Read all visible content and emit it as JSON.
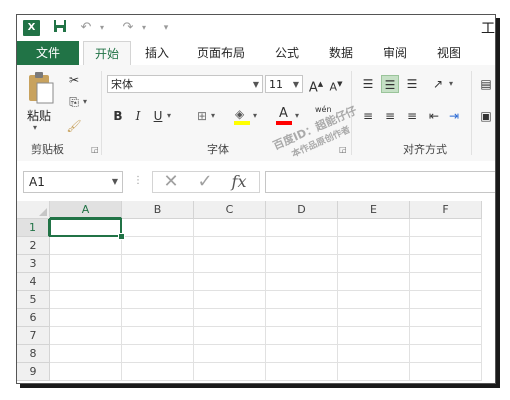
{
  "app": {
    "logo": "X",
    "title_fragment": "工"
  },
  "quick_access": {
    "save_icon": "save-icon",
    "undo_icon": "undo-icon",
    "redo_icon": "redo-icon",
    "customize_icon": "customize-qat-icon"
  },
  "tabs": [
    {
      "label": "文件"
    },
    {
      "label": "开始"
    },
    {
      "label": "插入"
    },
    {
      "label": "页面布局"
    },
    {
      "label": "公式"
    },
    {
      "label": "数据"
    },
    {
      "label": "审阅"
    },
    {
      "label": "视图"
    }
  ],
  "ribbon": {
    "clipboard": {
      "paste_label": "粘贴",
      "group_label": "剪贴板"
    },
    "font": {
      "font_name": "宋体",
      "font_size": "11",
      "grow_label": "A",
      "shrink_label": "A",
      "bold": "B",
      "italic": "I",
      "underline": "U",
      "font_color_label": "A",
      "wen_label": "wén",
      "group_label": "字体"
    },
    "alignment": {
      "group_label": "对齐方式"
    }
  },
  "watermark": {
    "line1": "百度ID：超能仔仔",
    "line2": "本作品原创作者"
  },
  "formula_bar": {
    "name_box": "A1",
    "formula": "",
    "fx_label": "fx"
  },
  "grid": {
    "columns": [
      "A",
      "B",
      "C",
      "D",
      "E",
      "F"
    ],
    "rows": [
      "1",
      "2",
      "3",
      "4",
      "5",
      "6",
      "7",
      "8",
      "9"
    ],
    "selected_cell": "A1"
  },
  "colors": {
    "accent": "#217346",
    "highlight_yellow": "#ffff00",
    "font_red": "#ff0000"
  }
}
